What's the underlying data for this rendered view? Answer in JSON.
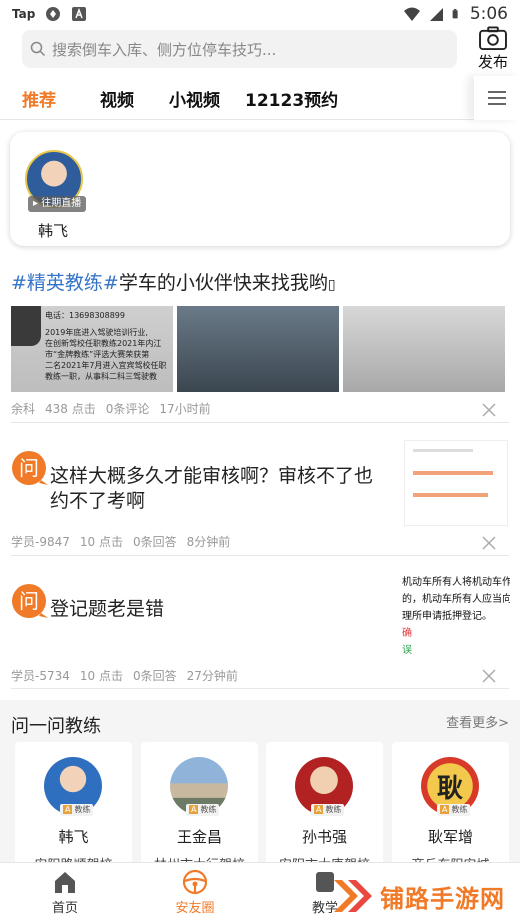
{
  "status_bar": {
    "left_label": "Tap",
    "time": "5:06"
  },
  "search": {
    "placeholder": "搜索倒车入库、侧方位停车技巧..."
  },
  "publish": {
    "label": "发布"
  },
  "tabs": [
    {
      "label": "推荐",
      "active": true
    },
    {
      "label": "视频",
      "active": false
    },
    {
      "label": "小视频",
      "active": false
    },
    {
      "label": "12123预约",
      "active": false
    }
  ],
  "live": {
    "badge": "往期直播",
    "name": "韩飞"
  },
  "article": {
    "tag": "#精英教练#",
    "title": "学车的小伙伴快来找我哟",
    "image1_lines": [
      "电话：13698308899",
      "2019年底进入驾驶培训行业,",
      "在创新驾校任职教练2021年内江",
      "市“金牌教练”评选大赛荣获第",
      "二名2021年7月进入宜宾驾校任职",
      "教练一职，从事科二科三驾驶教"
    ],
    "meta": {
      "author": "余科",
      "clicks": "438 点击",
      "comments": "0条评论",
      "time": "17小时前"
    }
  },
  "qa": [
    {
      "icon_char": "问",
      "text": "这样大概多久才能审核啊？审核不了也约不了考啊",
      "meta": {
        "author": "学员-9847",
        "clicks": "10 点击",
        "answers": "0条回答",
        "time": "8分钟前"
      }
    },
    {
      "icon_char": "问",
      "text": "登记题老是错",
      "thumb_lines": [
        "机动车所有人将机动车作为",
        "的，机动车所有人应当向",
        "理所申请抵押登记。",
        "确",
        "误"
      ],
      "meta": {
        "author": "学员-5734",
        "clicks": "10 点击",
        "answers": "0条回答",
        "time": "27分钟前"
      }
    }
  ],
  "ask_coach": {
    "title": "问一问教练",
    "more": "查看更多>",
    "badge_label": "教练",
    "coaches": [
      {
        "name": "韩飞",
        "school": "安阳路顺驾校"
      },
      {
        "name": "王金昌",
        "school": "林州市大行驾校"
      },
      {
        "name": "孙书强",
        "school": "安阳市大唐驾校"
      },
      {
        "name": "耿军增",
        "avatar_char": "耿",
        "school": "商丘东阳安城"
      }
    ]
  },
  "bottom_nav": [
    {
      "label": "首页",
      "icon": "home-icon",
      "active": false
    },
    {
      "label": "安友圈",
      "icon": "steering-wheel-icon",
      "active": true
    },
    {
      "label": "教学",
      "icon": "teach-icon",
      "active": false
    }
  ],
  "watermark": {
    "text": "铺路手游网"
  },
  "colors": {
    "accent": "#f07a28",
    "tag_blue": "#3575c9",
    "meta_gray": "#999999"
  }
}
